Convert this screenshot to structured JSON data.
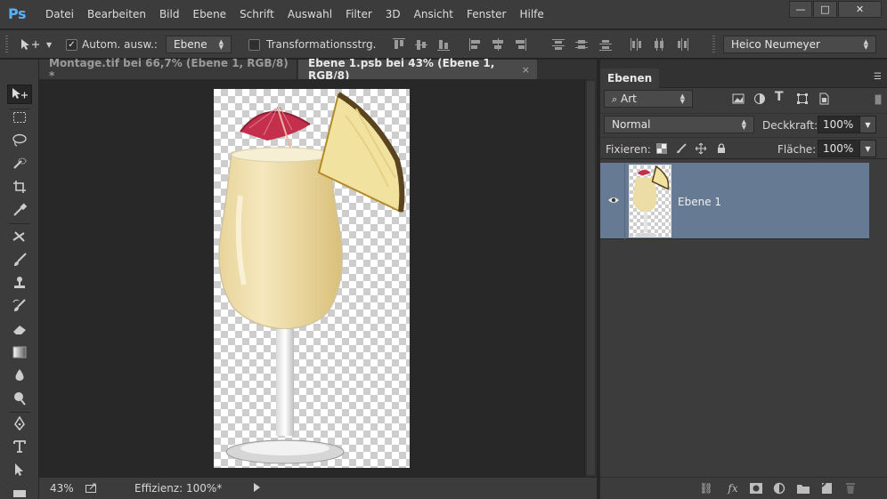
{
  "app": {
    "logo": "Ps"
  },
  "menu": [
    "Datei",
    "Bearbeiten",
    "Bild",
    "Ebene",
    "Schrift",
    "Auswahl",
    "Filter",
    "3D",
    "Ansicht",
    "Fenster",
    "Hilfe"
  ],
  "window": {
    "minimize": "—",
    "maximize": "□",
    "close": "✕"
  },
  "options": {
    "auto_select_checked": "✓",
    "auto_select_label": "Autom. ausw.:",
    "auto_select_target": "Ebene",
    "transform_label": "Transformationsstrg.",
    "workspace": "Heico Neumeyer"
  },
  "tabs": [
    {
      "title": "Montage.tif bei 66,7% (Ebene 1, RGB/8) *"
    },
    {
      "title": "Ebene 1.psb bei 43% (Ebene 1, RGB/8)"
    }
  ],
  "tab_close": "×",
  "status": {
    "zoom": "43%",
    "efficiency": "Effizienz: 100%*"
  },
  "layers_panel": {
    "tab": "Ebenen",
    "filter_type": "Art",
    "blend_mode": "Normal",
    "opacity_label": "Deckkraft:",
    "opacity_value": "100%",
    "lock_label": "Fixieren:",
    "fill_label": "Fläche:",
    "fill_value": "100%",
    "layers": [
      {
        "name": "Ebene 1",
        "selected": true
      }
    ]
  },
  "colors": {
    "accent_logo": "#56b1ff",
    "selected_layer": "#667a93",
    "panel_bg": "#3c3c3c",
    "canvas_bg": "#282828"
  }
}
